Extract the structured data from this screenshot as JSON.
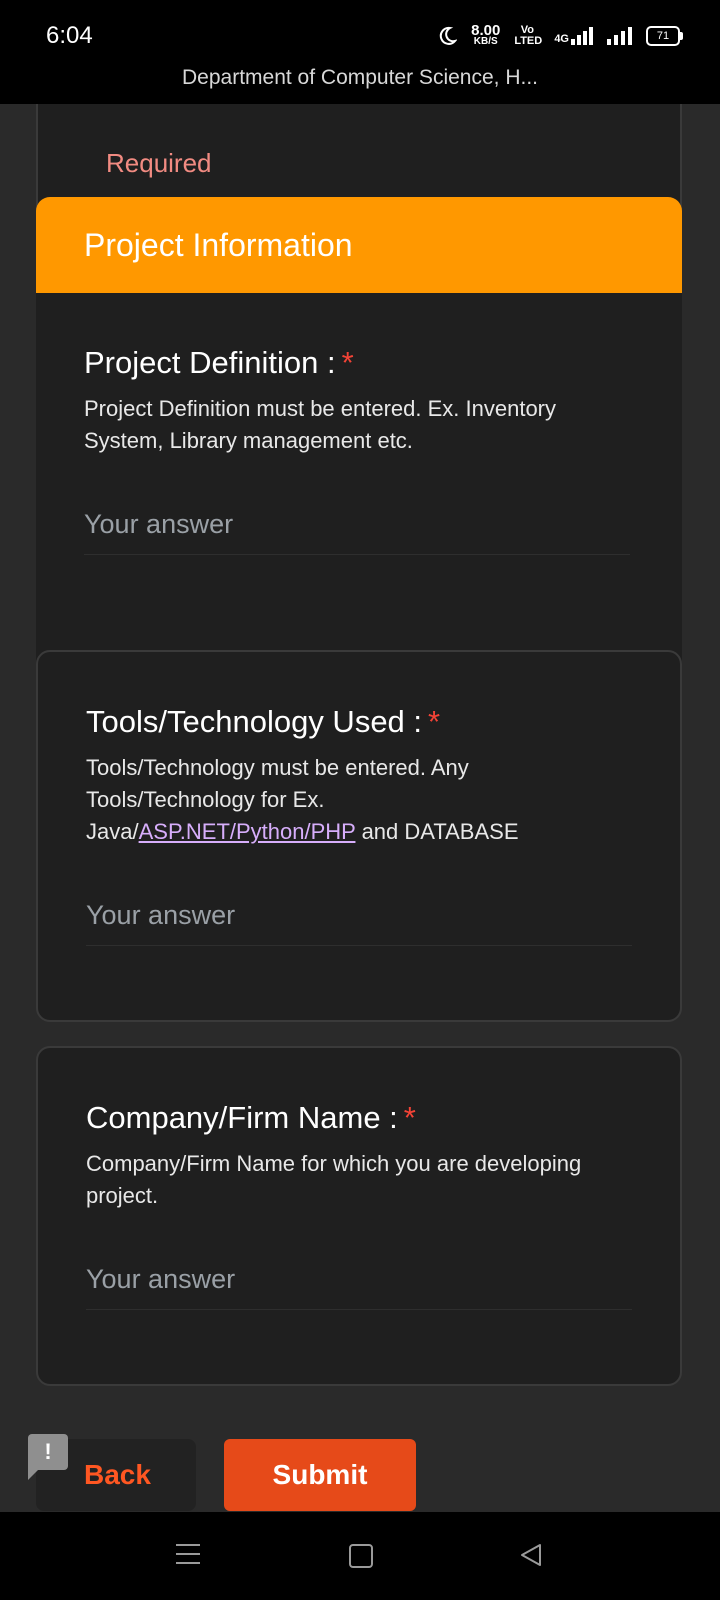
{
  "status": {
    "time": "6:04",
    "speed_value": "8.00",
    "speed_unit": "KB/S",
    "volte": "Vo LTED",
    "network": "4G",
    "battery": "71"
  },
  "browser": {
    "title": "Department of Computer Science, H..."
  },
  "previous_section": {
    "required_text": "Required"
  },
  "section": {
    "title": "Project Information"
  },
  "questions": [
    {
      "title": "Project Definition :",
      "required_mark": "*",
      "desc": "Project Definition must be entered. Ex. Inventory System, Library management etc.",
      "placeholder": "Your answer"
    },
    {
      "title": "Tools/Technology Used :",
      "required_mark": "*",
      "desc_line1": "Tools/Technology must be entered. Any Tools/Technology for Ex.",
      "desc_pre": "Java/",
      "desc_link": "ASP.NET/Python/PHP",
      "desc_post": " and DATABASE",
      "placeholder": "Your answer"
    },
    {
      "title": "Company/Firm Name :",
      "required_mark": "*",
      "desc": "Company/Firm Name for which you are developing project.",
      "placeholder": "Your answer"
    }
  ],
  "actions": {
    "back_label": "Back",
    "submit_label": "Submit",
    "feedback_icon": "!"
  },
  "colors": {
    "accent": "#ff9800",
    "submit": "#e64a19",
    "back_text": "#ff5722",
    "required": "#f44336"
  }
}
